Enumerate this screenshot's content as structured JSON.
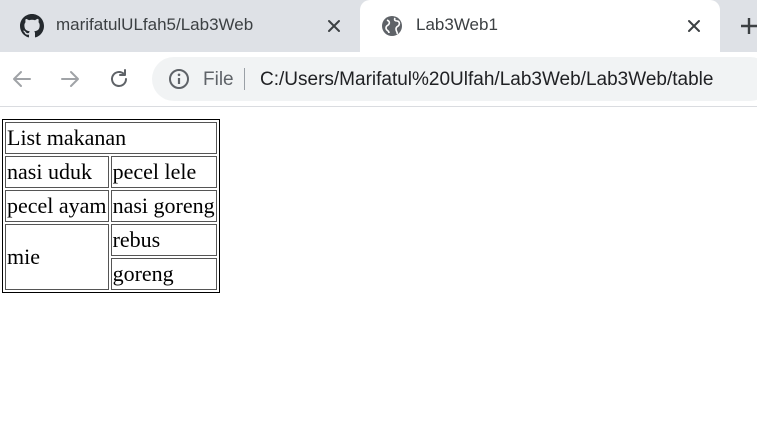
{
  "tabs": [
    {
      "title": "marifatulULfah5/Lab3Web",
      "icon": "github-icon",
      "active": false
    },
    {
      "title": "Lab3Web1",
      "icon": "globe-icon",
      "active": true
    }
  ],
  "toolbar": {
    "scheme": "File",
    "url": "C:/Users/Marifatul%20Ulfah/Lab3Web/Lab3Web/table"
  },
  "table": {
    "header": "List makanan",
    "rows": [
      [
        "nasi uduk",
        "pecel lele"
      ],
      [
        "pecel ayam",
        "nasi goreng"
      ]
    ],
    "rowspan_label": "mie",
    "rowspan_items": [
      "rebus",
      "goreng"
    ]
  },
  "colors": {
    "tabstrip_bg": "#dee1e6",
    "omnibox_bg": "#f1f3f4",
    "icon_color": "#5f6368"
  }
}
